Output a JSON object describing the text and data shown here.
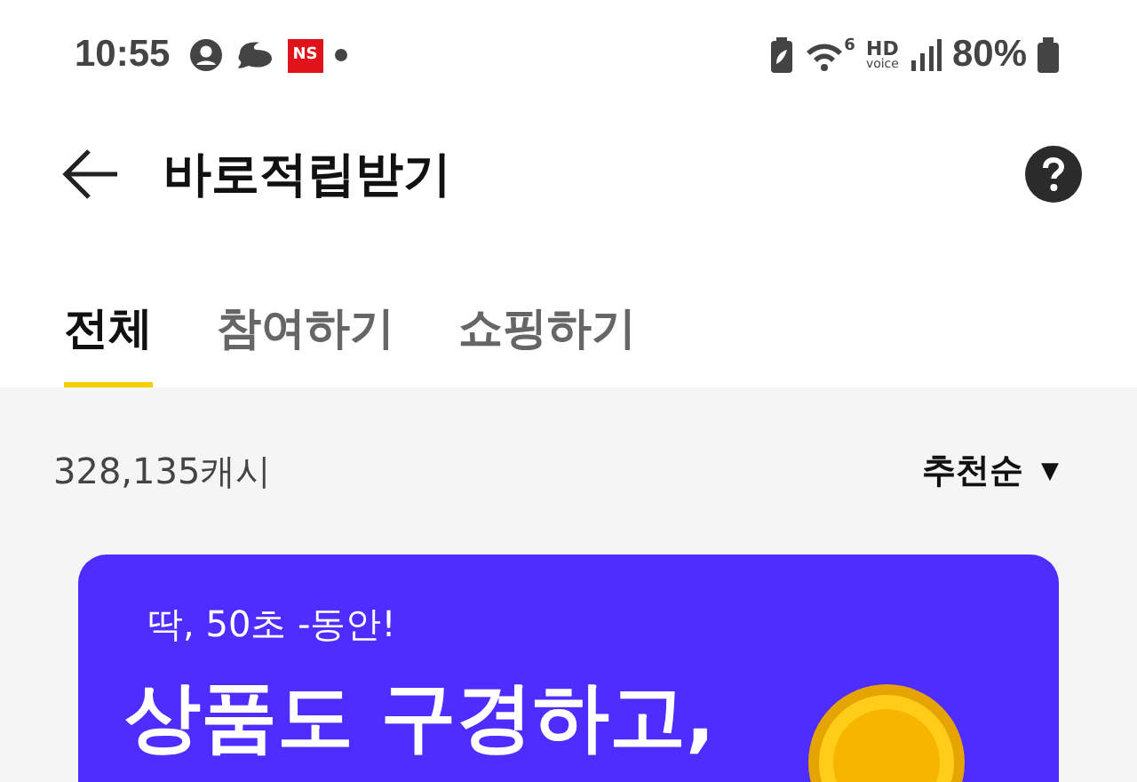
{
  "status_bar": {
    "time": "10:55",
    "badge": "NS",
    "wifi_band": "6",
    "hd": "HD",
    "voice": "voice",
    "battery": "80%"
  },
  "header": {
    "title": "바로적립받기"
  },
  "tabs": [
    {
      "label": "전체",
      "selected": true
    },
    {
      "label": "참여하기",
      "selected": false
    },
    {
      "label": "쇼핑하기",
      "selected": false
    }
  ],
  "summary": {
    "cash": "328,135캐시",
    "sort": "추천순",
    "sort_caret": "▼"
  },
  "banner": {
    "eyebrow": "딱, 50초 -동안!",
    "headline": "상품도 구경하고,"
  }
}
